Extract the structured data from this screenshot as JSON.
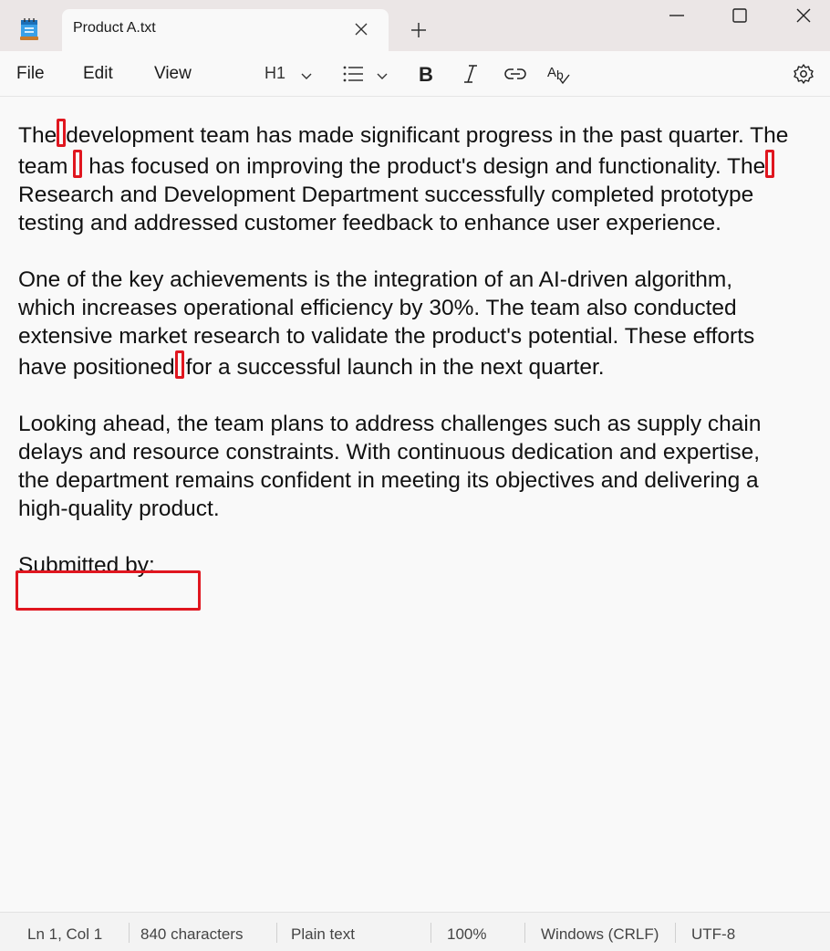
{
  "window": {
    "app_icon": "notepad-icon",
    "tab_title": "Product A.txt"
  },
  "menu": {
    "file": "File",
    "edit": "Edit",
    "view": "View"
  },
  "toolbar": {
    "heading": "H1",
    "list_icon": "list-icon",
    "bold_icon": "bold-icon",
    "italic_icon": "italic-icon",
    "link_icon": "link-icon",
    "spellcheck_icon": "spellcheck-icon",
    "settings_icon": "gear-icon"
  },
  "document": {
    "p1": {
      "l1a": "The",
      "l1b": "development team has made significant progress in the past quarter. The",
      "l2a": "team",
      "l2b": " has focused on improving the product's design and functionality. The",
      "l3": "Research and Development Department successfully completed prototype",
      "l4": "testing and addressed customer feedback to enhance user experience."
    },
    "p2": {
      "l1": "One of the key achievements is the integration of an AI-driven algorithm,",
      "l2": "which increases operational efficiency by 30%. The team also conducted",
      "l3": "extensive market research to validate the product's potential. These efforts",
      "l4a": "have positioned",
      "l4b": "for a successful launch in the next quarter."
    },
    "p3": {
      "l1": "Looking ahead, the team plans to address challenges such as supply chain",
      "l2": "delays and resource constraints. With continuous dedication and expertise,",
      "l3": "the department remains confident in meeting its objectives and delivering a",
      "l4": "high-quality product."
    },
    "signature_label": "Submitted by:"
  },
  "highlight_color": "#e0161f",
  "status": {
    "position": "Ln 1, Col 1",
    "characters": "840 characters",
    "format": "Plain text",
    "zoom": "100%",
    "line_ending": "Windows (CRLF)",
    "encoding": "UTF-8"
  }
}
